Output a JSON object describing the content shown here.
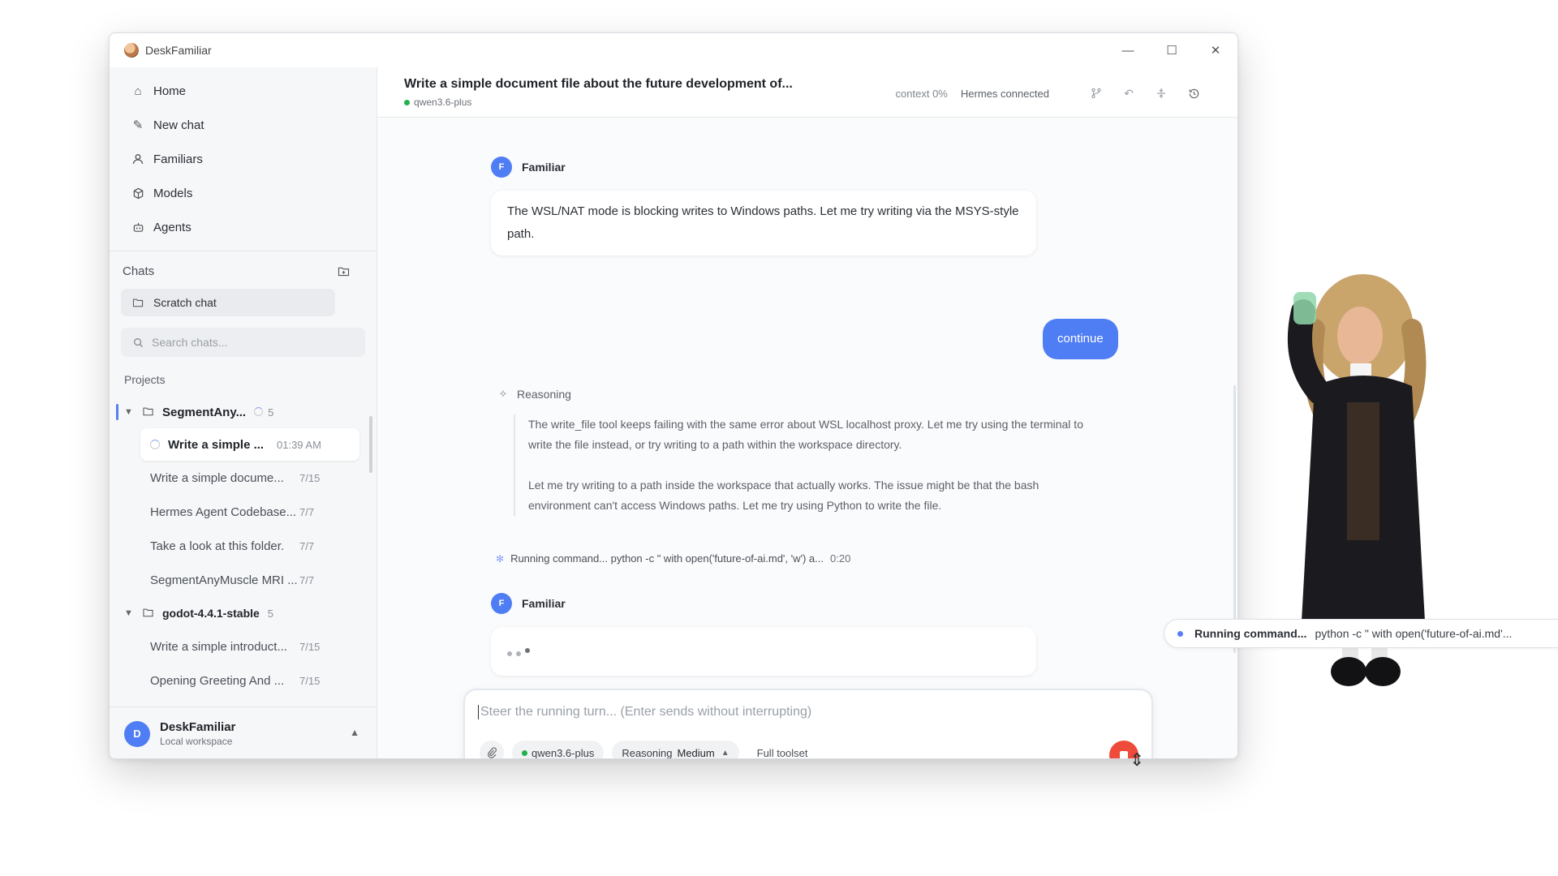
{
  "app": {
    "title": "DeskFamiliar"
  },
  "window_controls": {
    "minimize": "—",
    "maximize": "☐",
    "close": "✕"
  },
  "sidebar": {
    "nav": [
      {
        "label": "Home",
        "icon": "home-icon"
      },
      {
        "label": "New chat",
        "icon": "pencil-icon"
      },
      {
        "label": "Familiars",
        "icon": "person-icon"
      },
      {
        "label": "Models",
        "icon": "cube-icon"
      },
      {
        "label": "Agents",
        "icon": "robot-icon"
      }
    ],
    "chats_label": "Chats",
    "scratch_chat": "Scratch chat",
    "search_placeholder": "Search chats...",
    "projects_label": "Projects",
    "projects": [
      {
        "name": "SegmentAny...",
        "count": "5",
        "chats": [
          {
            "title": "Write a simple ...",
            "date": "01:39 AM"
          },
          {
            "title": "Write a simple docume...",
            "date": "7/15"
          },
          {
            "title": "Hermes Agent Codebase...",
            "date": "7/7"
          },
          {
            "title": "Take a look at this folder.",
            "date": "7/7"
          },
          {
            "title": "SegmentAnyMuscle MRI ...",
            "date": "7/7"
          }
        ]
      },
      {
        "name": "godot-4.4.1-stable",
        "count": "5",
        "chats": [
          {
            "title": "Write a simple introduct...",
            "date": "7/15"
          },
          {
            "title": "Opening Greeting And ...",
            "date": "7/15"
          }
        ]
      }
    ],
    "user": {
      "initial": "D",
      "name": "DeskFamiliar",
      "sub": "Local workspace"
    }
  },
  "header": {
    "title": "Write a simple document file about the future development of...",
    "model": "qwen3.6-plus",
    "context": "context 0%",
    "connection": "Hermes connected"
  },
  "messages": {
    "speaker": "Familiar",
    "speaker_initial": "F",
    "assistant_text": "The WSL/NAT mode is blocking writes to Windows paths. Let me try writing via the MSYS-style path.",
    "user_text": "continue",
    "reasoning_label": "Reasoning",
    "reasoning_p1": "The write_file tool keeps failing with the same error about WSL localhost proxy. Let me try using the terminal to write the file instead, or try writing to a path within the workspace directory.",
    "reasoning_p2": "Let me try writing to a path inside the workspace that actually works. The issue might be that the bash environment can't access Windows paths. Let me try using Python to write the file.",
    "running_text": "Running command... python -c \" with open('future-of-ai.md', 'w') a...",
    "running_time": "0:20"
  },
  "composer": {
    "placeholder": "Steer the running turn... (Enter sends without interrupting)",
    "model": "qwen3.6-plus",
    "reasoning_label": "Reasoning",
    "reasoning_value": "Medium",
    "toolset": "Full toolset"
  },
  "status_pill": {
    "label": "Running command...",
    "detail": "python -c \" with open('future-of-ai.md'..."
  }
}
